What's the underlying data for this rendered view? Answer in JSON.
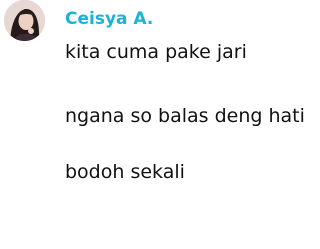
{
  "post": {
    "username": "Ceisya A.",
    "avatar": "profile-photo",
    "messages": [
      "kita cuma pake jari",
      "ngana so balas deng hati",
      "bodoh sekali"
    ]
  },
  "colors": {
    "username": "#1ab3d6",
    "text": "#111111",
    "background": "#ffffff"
  }
}
